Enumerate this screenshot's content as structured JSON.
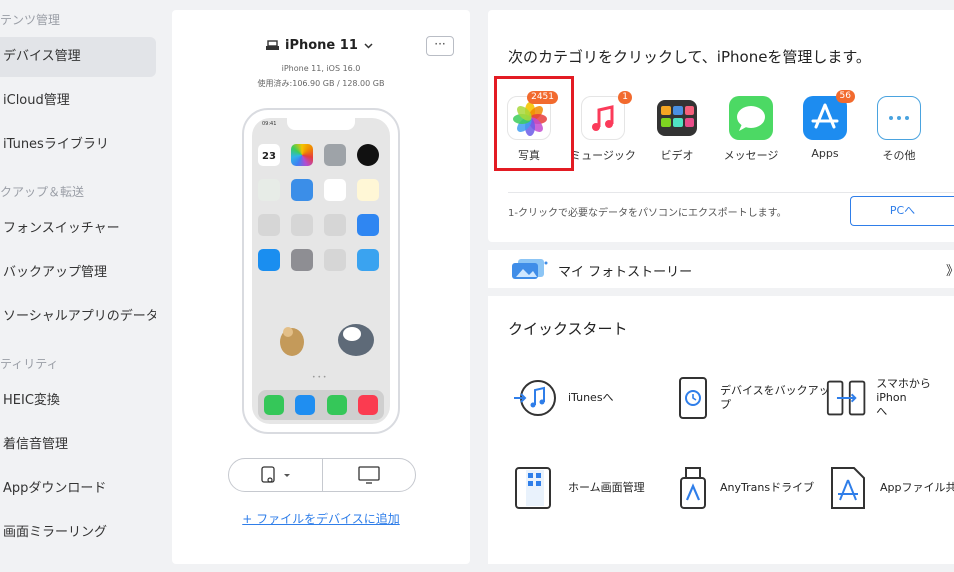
{
  "sidebar": {
    "sections": [
      "テンツ管理",
      "クアップ＆転送",
      "ティリティ"
    ],
    "items": [
      {
        "label": "デバイス管理",
        "active": true
      },
      {
        "label": "iCloud管理"
      },
      {
        "label": "iTunesライブラリ"
      },
      {
        "label": "フォンスイッチャー"
      },
      {
        "label": "バックアップ管理"
      },
      {
        "label": "ソーシャルアプリのデータ..."
      },
      {
        "label": "HEIC変換"
      },
      {
        "label": "着信音管理"
      },
      {
        "label": "Appダウンロード"
      },
      {
        "label": "画面ミラーリング"
      }
    ]
  },
  "device": {
    "name": "iPhone 11",
    "more": "···",
    "model": "iPhone 11, iOS 16.0",
    "usage": "使用済み:106.90 GB / 128.00 GB",
    "add_file": "+ ファイルをデバイスに追加",
    "status_time": "09:41",
    "calendar_day": "23"
  },
  "categories": {
    "title": "次のカテゴリをクリックして、iPhoneを管理します。",
    "items": [
      {
        "label": "写真",
        "badge": "2451"
      },
      {
        "label": "ミュージック",
        "badge": "1"
      },
      {
        "label": "ビデオ",
        "badge": ""
      },
      {
        "label": "メッセージ",
        "badge": ""
      },
      {
        "label": "Apps",
        "badge": "56"
      },
      {
        "label": "その他",
        "badge": ""
      }
    ],
    "export_text": "1-クリックで必要なデータをパソコンにエクスポートします。",
    "pc_button": "PCへ"
  },
  "story": {
    "label": "マイ フォトストーリー",
    "arrow": "》"
  },
  "quickstart": {
    "title": "クイックスタート",
    "items": [
      {
        "label": "iTunesへ"
      },
      {
        "label": "デバイスをバックアッ\nプ"
      },
      {
        "label": "スマホからiPhon\nへ"
      },
      {
        "label": "ホーム画面管理"
      },
      {
        "label": "AnyTransドライブ"
      },
      {
        "label": "Appファイル共有"
      }
    ]
  },
  "colors": {
    "accent": "#2f7ee9",
    "badge": "#f26a2e",
    "highlight": "#e31b23"
  }
}
